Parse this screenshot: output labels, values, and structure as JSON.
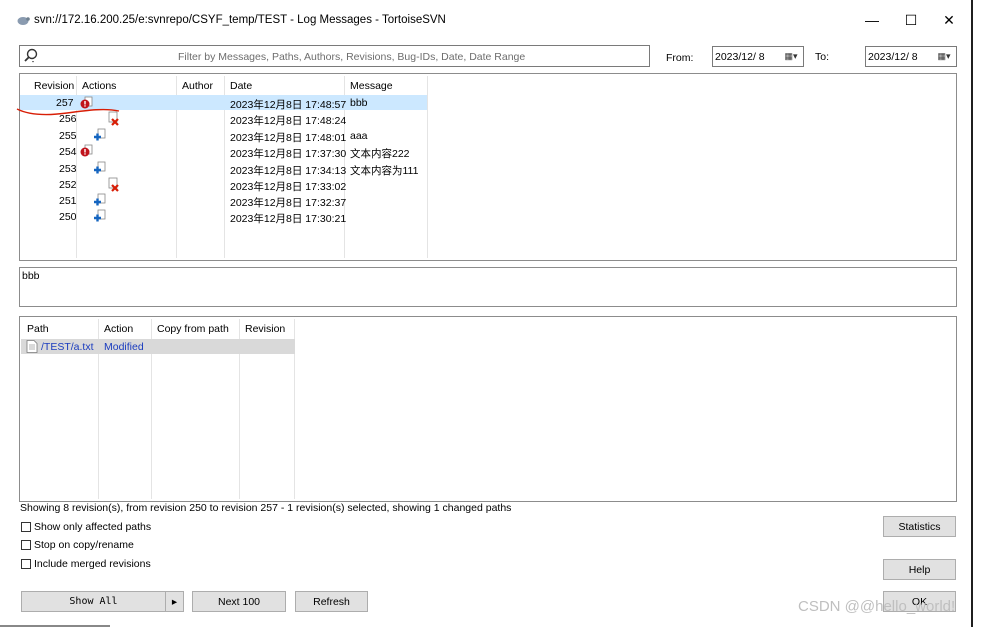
{
  "window": {
    "title": "svn://172.16.200.25/e:svnrepo/CSYF_temp/TEST - Log Messages - TortoiseSVN",
    "minimize": "—",
    "maximize": "☐",
    "close": "✕"
  },
  "filter": {
    "placeholder": "Filter by Messages, Paths, Authors, Revisions, Bug-IDs, Date, Date Range",
    "from_label": "From:",
    "from_value": "2023/12/ 8",
    "to_label": "To:",
    "to_value": "2023/12/ 8"
  },
  "log": {
    "headers": [
      "Revision",
      "Actions",
      "Author",
      "Date",
      "Message"
    ],
    "rows": [
      {
        "revision": "257",
        "action_icon": "modified-icon",
        "author": "",
        "date": "2023年12月8日 17:48:57",
        "message": "bbb",
        "selected": true
      },
      {
        "revision": "256",
        "action_icon": "deleted-icon",
        "author": "",
        "date": "2023年12月8日 17:48:24",
        "message": ""
      },
      {
        "revision": "255",
        "action_icon": "added-icon",
        "author": "",
        "date": "2023年12月8日 17:48:01",
        "message": "aaa"
      },
      {
        "revision": "254",
        "action_icon": "modified-icon",
        "author": "",
        "date": "2023年12月8日 17:37:30",
        "message": "文本内容222"
      },
      {
        "revision": "253",
        "action_icon": "added-icon",
        "author": "",
        "date": "2023年12月8日 17:34:13",
        "message": "文本内容为111"
      },
      {
        "revision": "252",
        "action_icon": "deleted-icon",
        "author": "",
        "date": "2023年12月8日 17:33:02",
        "message": ""
      },
      {
        "revision": "251",
        "action_icon": "added-icon",
        "author": "",
        "date": "2023年12月8日 17:32:37",
        "message": ""
      },
      {
        "revision": "250",
        "action_icon": "added-icon",
        "author": "",
        "date": "2023年12月8日 17:30:21",
        "message": ""
      }
    ]
  },
  "message_box": {
    "text": "bbb"
  },
  "paths": {
    "headers": [
      "Path",
      "Action",
      "Copy from path",
      "Revision"
    ],
    "rows": [
      {
        "path": "/TEST/a.txt",
        "action": "Modified",
        "copy_from": "",
        "revision": ""
      }
    ]
  },
  "status_text": "Showing 8 revision(s), from revision 250 to revision 257 - 1 revision(s) selected, showing 1 changed paths",
  "options": {
    "affected": "Show only affected paths",
    "stop_copy": "Stop on copy/rename",
    "merged": "Include merged revisions"
  },
  "buttons": {
    "show_all": "Show All",
    "show_all_arrow": "▸",
    "next100": "Next 100",
    "refresh": "Refresh",
    "statistics": "Statistics",
    "help": "Help",
    "ok": "OK"
  },
  "watermark": "CSDN @@hello_world!",
  "colors": {
    "selection": "#cce8ff",
    "deleted": "#d81e06",
    "added": "#1565c0",
    "modified": "#c0141c",
    "link": "#1a3cbf"
  }
}
